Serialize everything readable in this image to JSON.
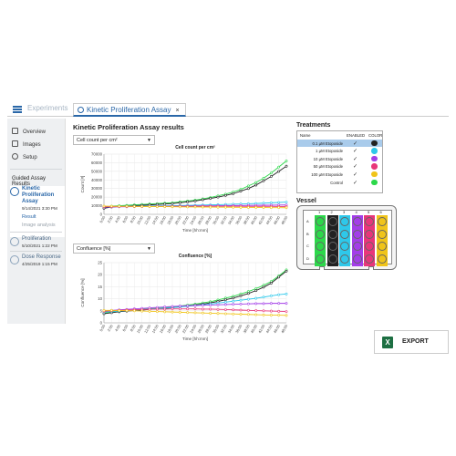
{
  "tabs": {
    "experiments": "Experiments",
    "active": "Kinetic Proliferation Assay",
    "close": "×"
  },
  "sidebar": {
    "nav": [
      {
        "label": "Overview",
        "icon": "overview-icon"
      },
      {
        "label": "Images",
        "icon": "images-icon"
      },
      {
        "label": "Setup",
        "icon": "setup-icon"
      }
    ],
    "section_title": "Guided Assay Results",
    "assays": [
      {
        "name_lines": [
          "Kinetic",
          "Proliferation",
          "Assay"
        ],
        "date": "9/14/2021 3:30 PM",
        "subitems": [
          "Result",
          "Image analysis"
        ]
      },
      {
        "name_lines": [
          "Proliferation"
        ],
        "date": "5/10/2021 1:22 PM"
      },
      {
        "name_lines": [
          "Dose Response"
        ],
        "date": "4/25/2019 1:15 PM"
      }
    ]
  },
  "results_title": "Kinetic Proliferation Assay results",
  "charts": [
    {
      "dropdown": "Cell count per cm²"
    },
    {
      "dropdown": "Confluence [%]"
    }
  ],
  "chart_data": [
    {
      "type": "line",
      "title": "Cell count per cm²",
      "xlabel": "Time [hh:mm]",
      "ylabel": "Count [#]",
      "ylim": [
        0,
        70000
      ],
      "yticks": [
        "0",
        "10000",
        "20000",
        "30000",
        "40000",
        "50000",
        "60000",
        "70000"
      ],
      "x": [
        "0:00",
        "2:00",
        "4:00",
        "6:00",
        "8:00",
        "10:00",
        "12:00",
        "14:00",
        "16:00",
        "18:00",
        "20:00",
        "22:00",
        "24:00",
        "26:00",
        "28:00",
        "30:00",
        "32:00",
        "34:00",
        "36:00",
        "38:00",
        "40:00",
        "42:00",
        "44:00",
        "46:00",
        "48:00"
      ],
      "grid": true,
      "series": [
        {
          "color": "#2cd84a",
          "values": [
            8000,
            9500,
            10000,
            10500,
            11000,
            11500,
            12000,
            12500,
            13000,
            13500,
            14500,
            15500,
            16500,
            18000,
            19500,
            21500,
            23500,
            26000,
            29000,
            33000,
            37000,
            42000,
            48000,
            55000,
            62000
          ]
        },
        {
          "color": "#222222",
          "values": [
            7000,
            8500,
            9000,
            9500,
            10000,
            10500,
            11000,
            11500,
            12000,
            12500,
            13500,
            14500,
            15500,
            17000,
            18500,
            20000,
            22000,
            24000,
            27000,
            30000,
            34000,
            39000,
            44000,
            50000,
            56000
          ]
        },
        {
          "color": "#2ec8ea",
          "values": [
            9000,
            9100,
            9200,
            9300,
            9400,
            9500,
            9700,
            9800,
            9900,
            10000,
            10200,
            10400,
            10600,
            10800,
            11000,
            11200,
            11500,
            11800,
            12000,
            12300,
            12600,
            13000,
            13400,
            13800,
            14200
          ]
        },
        {
          "color": "#a33ee8",
          "values": [
            8500,
            8600,
            8700,
            8800,
            8900,
            9000,
            9100,
            9200,
            9300,
            9400,
            9500,
            9600,
            9700,
            9800,
            9900,
            10000,
            10100,
            10200,
            10300,
            10400,
            10500,
            10600,
            10700,
            10800,
            10900
          ]
        },
        {
          "color": "#e8367a",
          "values": [
            9000,
            9000,
            9100,
            9100,
            9100,
            9200,
            9200,
            9200,
            9200,
            9200,
            9300,
            9300,
            9300,
            9300,
            9300,
            9300,
            9300,
            9300,
            9300,
            9200,
            9200,
            9200,
            9200,
            9100,
            9100
          ]
        },
        {
          "color": "#f0c419",
          "values": [
            9500,
            9400,
            9300,
            9300,
            9200,
            9100,
            9000,
            8900,
            8900,
            8800,
            8700,
            8600,
            8600,
            8500,
            8400,
            8300,
            8300,
            8200,
            8100,
            8000,
            8000,
            7900,
            7800,
            7800,
            7700
          ]
        }
      ]
    },
    {
      "type": "line",
      "title": "Confluence [%]",
      "xlabel": "Time [hh:mm]",
      "ylabel": "Confluence [%]",
      "ylim": [
        0,
        25
      ],
      "yticks": [
        "0",
        "5",
        "10",
        "15",
        "20",
        "25"
      ],
      "x": [
        "0:00",
        "2:00",
        "4:00",
        "6:00",
        "8:00",
        "10:00",
        "12:00",
        "14:00",
        "16:00",
        "18:00",
        "20:00",
        "22:00",
        "24:00",
        "26:00",
        "28:00",
        "30:00",
        "32:00",
        "34:00",
        "36:00",
        "38:00",
        "40:00",
        "42:00",
        "44:00",
        "46:00",
        "48:00"
      ],
      "grid": true,
      "series": [
        {
          "color": "#2cd84a",
          "values": [
            4,
            4.5,
            5,
            5.2,
            5.4,
            5.6,
            5.9,
            6.1,
            6.3,
            6.6,
            7,
            7.4,
            7.8,
            8.3,
            8.8,
            9.5,
            10.3,
            11,
            12,
            13,
            14.2,
            15.6,
            17.2,
            19.5,
            22
          ]
        },
        {
          "color": "#222222",
          "values": [
            3.8,
            4.2,
            4.6,
            4.9,
            5.1,
            5.3,
            5.6,
            5.8,
            6,
            6.3,
            6.7,
            7,
            7.4,
            7.8,
            8.3,
            8.9,
            9.6,
            10.3,
            11.2,
            12.2,
            13.4,
            14.8,
            16.5,
            19,
            21.5
          ]
        },
        {
          "color": "#2ec8ea",
          "values": [
            4.5,
            4.7,
            4.9,
            5.1,
            5.3,
            5.5,
            5.7,
            5.9,
            6.1,
            6.3,
            6.6,
            6.9,
            7.2,
            7.5,
            7.8,
            8.2,
            8.6,
            9,
            9.4,
            9.8,
            10.2,
            10.7,
            11.2,
            11.7,
            12
          ]
        },
        {
          "color": "#a33ee8",
          "values": [
            5,
            5.2,
            5.4,
            5.6,
            5.8,
            6,
            6.2,
            6.4,
            6.6,
            6.8,
            7,
            7.1,
            7.2,
            7.3,
            7.4,
            7.5,
            7.6,
            7.7,
            7.8,
            7.9,
            8,
            8,
            8.1,
            8.1,
            8.1
          ]
        },
        {
          "color": "#e8367a",
          "values": [
            4.8,
            5,
            5.2,
            5.3,
            5.4,
            5.5,
            5.6,
            5.7,
            5.7,
            5.8,
            5.8,
            5.8,
            5.8,
            5.7,
            5.7,
            5.6,
            5.5,
            5.4,
            5.3,
            5.2,
            5.1,
            5,
            4.9,
            4.8,
            4.7
          ]
        },
        {
          "color": "#f0c419",
          "values": [
            5.2,
            5.2,
            5.1,
            5.1,
            5,
            4.9,
            4.8,
            4.7,
            4.6,
            4.5,
            4.4,
            4.3,
            4.2,
            4.1,
            4,
            3.9,
            3.8,
            3.7,
            3.6,
            3.5,
            3.4,
            3.3,
            3.2,
            3.2,
            3.1
          ]
        }
      ]
    }
  ],
  "treatments": {
    "title": "Treatments",
    "headers": {
      "name": "Name",
      "enabled": "ENABLED",
      "color": "COLOR"
    },
    "rows": [
      {
        "name": "0.1 µM Etoposide",
        "check": "✓",
        "color": "#222222",
        "selected": true
      },
      {
        "name": "1 µM Etoposide",
        "check": "✓",
        "color": "#2ec8ea"
      },
      {
        "name": "10 µM Etoposide",
        "check": "✓",
        "color": "#a33ee8"
      },
      {
        "name": "50 µM Etoposide",
        "check": "✓",
        "color": "#e8367a"
      },
      {
        "name": "100 µM Etoposide",
        "check": "✓",
        "color": "#f0c419"
      },
      {
        "name": "Control",
        "check": "✓",
        "color": "#2cd84a"
      }
    ]
  },
  "vessel": {
    "title": "Vessel",
    "row_labels": [
      "A",
      "B",
      "C",
      "D"
    ],
    "col_labels": [
      "1",
      "2",
      "3",
      "4",
      "5",
      "6"
    ],
    "columns": [
      {
        "fill": "#2cd84a",
        "well": "#2cd84a"
      },
      {
        "fill": "#222222",
        "well": "#222222"
      },
      {
        "fill": "#2ec8ea",
        "well": "#2ec8ea"
      },
      {
        "fill": "#a33ee8",
        "well": "#a33ee8"
      },
      {
        "fill": "#e8367a",
        "well": "#e8367a"
      },
      {
        "fill": "#f0c419",
        "well": "#f0c419"
      }
    ]
  },
  "export": {
    "label": "EXPORT",
    "icon_letter": "X"
  }
}
